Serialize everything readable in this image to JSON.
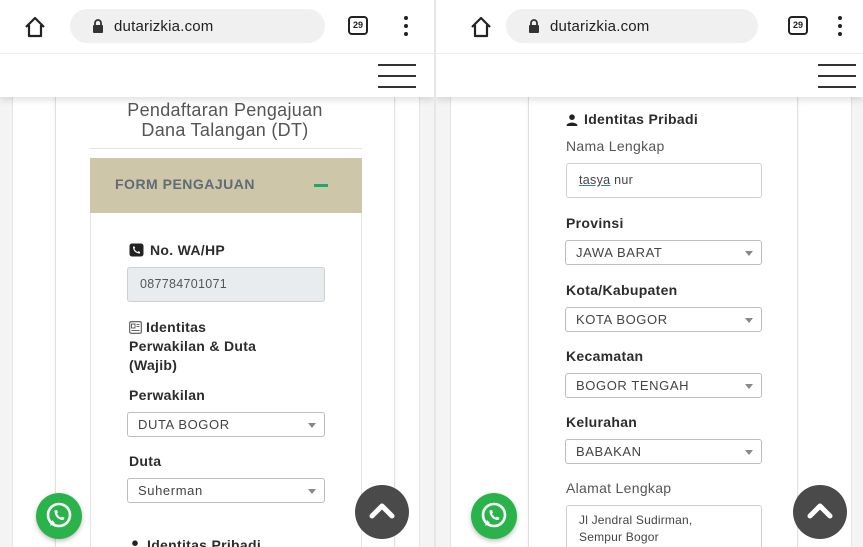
{
  "browser": {
    "url": "dutarizkia.com",
    "tab_count": "29"
  },
  "left": {
    "title_line1": "Pendaftaran Pengajuan",
    "title_line2": "Dana Talangan (DT)",
    "accordion_label": "FORM PENGAJUAN",
    "wa_label": "No. WA/HP",
    "wa_value": "087784701071",
    "identity_line1": "Identitas",
    "identity_line2": "Perwakilan & Duta",
    "identity_line3": "(Wajib)",
    "perwakilan_label": "Perwakilan",
    "perwakilan_value": "DUTA BOGOR",
    "duta_label": "Duta",
    "duta_value": "Suherman",
    "cut_heading": "Identitas Pribadi"
  },
  "right": {
    "identity_heading": "Identitas Pribadi",
    "nama_label": "Nama Lengkap",
    "nama_value_part1": "tasya",
    "nama_value_part2": " nur",
    "provinsi_label": "Provinsi",
    "provinsi_value": "JAWA BARAT",
    "kota_label": "Kota/Kabupaten",
    "kota_value": "KOTA BOGOR",
    "kecamatan_label": "Kecamatan",
    "kecamatan_value": "BOGOR TENGAH",
    "kelurahan_label": "Kelurahan",
    "kelurahan_value": "BABAKAN",
    "alamat_label": "Alamat Lengkap",
    "alamat_line1": "Jl Jendral Sudirman,",
    "alamat_line2": "Sempur Bogor"
  },
  "colors": {
    "accordion_bg": "#cdc6a8",
    "accent_green": "#1fa86a",
    "whatsapp_green": "#29b34a",
    "scroll_top_bg": "#4a4a4a"
  },
  "icons": {
    "home": "home-icon",
    "lock": "lock-icon",
    "tabs": "tab-count-icon",
    "menu": "kebab-menu-icon",
    "nav": "hamburger-icon",
    "phone": "phone-icon",
    "id_card": "id-card-icon",
    "user": "user-icon",
    "whatsapp": "whatsapp-icon",
    "scroll_top": "chevron-up-icon"
  }
}
